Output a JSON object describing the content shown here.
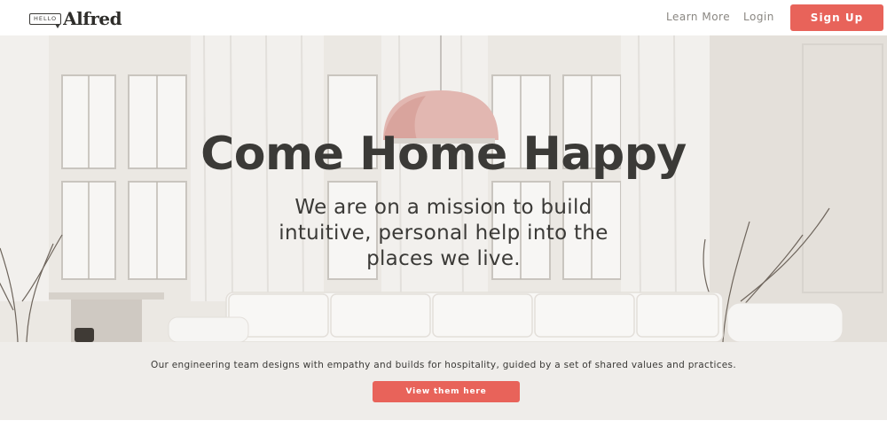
{
  "header": {
    "logo_badge": "HELLO",
    "logo_word": "Alfred",
    "nav": [
      {
        "label": "Learn More"
      },
      {
        "label": "Login"
      }
    ],
    "signup_label": "Sign Up"
  },
  "hero": {
    "title": "Come Home Happy",
    "subtitle_lines": [
      "We are on a mission to build",
      "intuitive, personal help into the",
      "places we live."
    ]
  },
  "values_band": {
    "text": "Our engineering team designs with empathy and builds for hospitality, guided by a set of shared values and practices.",
    "button_label": "View them here"
  },
  "colors": {
    "accent": "#e8635a",
    "text_dark": "#3b3a37",
    "nav_text": "#8a8782",
    "band_bg": "#efedea"
  },
  "icons": {
    "logo": "speech-bubble-logo-icon"
  }
}
